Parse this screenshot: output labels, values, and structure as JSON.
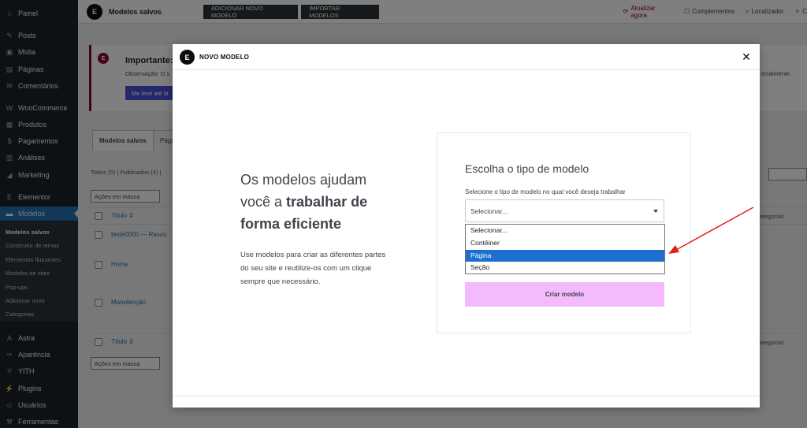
{
  "sidebar": {
    "items": [
      {
        "label": "Painel",
        "icon": "dashboard-icon",
        "glyph": "⌂"
      },
      {
        "label": "Posts",
        "icon": "pin-icon",
        "glyph": "✎"
      },
      {
        "label": "Mídia",
        "icon": "media-icon",
        "glyph": "▣"
      },
      {
        "label": "Páginas",
        "icon": "pages-icon",
        "glyph": "▤"
      },
      {
        "label": "Comentários",
        "icon": "comments-icon",
        "glyph": "✉"
      },
      {
        "label": "WooCommerce",
        "icon": "woocommerce-icon",
        "glyph": "W"
      },
      {
        "label": "Produtos",
        "icon": "products-icon",
        "glyph": "▦"
      },
      {
        "label": "Pagamentos",
        "icon": "payments-icon",
        "glyph": "$"
      },
      {
        "label": "Análises",
        "icon": "analytics-icon",
        "glyph": "▥"
      },
      {
        "label": "Marketing",
        "icon": "megaphone-icon",
        "glyph": "◢"
      },
      {
        "label": "Elementor",
        "icon": "elementor-icon",
        "glyph": "E"
      },
      {
        "label": "Modelos",
        "icon": "folder-icon",
        "glyph": "▬"
      },
      {
        "label": "Astra",
        "icon": "astra-icon",
        "glyph": "A"
      },
      {
        "label": "Aparência",
        "icon": "brush-icon",
        "glyph": "✑"
      },
      {
        "label": "YITH",
        "icon": "yith-icon",
        "glyph": "Y"
      },
      {
        "label": "Plugins",
        "icon": "plug-icon",
        "glyph": "⚡"
      },
      {
        "label": "Usuários",
        "icon": "users-icon",
        "glyph": "☺"
      },
      {
        "label": "Ferramentas",
        "icon": "wrench-icon",
        "glyph": "⚒"
      }
    ],
    "submenu": [
      "Modelos salvos",
      "Construtor de temas",
      "Elementos flutuantes",
      "Modelos de sites",
      "Pop-ups",
      "Adicionar novo",
      "Categorias"
    ]
  },
  "topbar": {
    "title": "Modelos salvos",
    "add_new": "Adicionar novo modelo",
    "import": "Importar modelos",
    "update_now": "Atualizar agora",
    "complements": "Complementos",
    "finder": "Localizador",
    "connected": "C"
  },
  "notice": {
    "title": "Importante:",
    "body": "Observação: O s",
    "body_end": "ecialmente.",
    "button": "Me leve até lá"
  },
  "tabs": [
    "Modelos salvos",
    "Pági"
  ],
  "filters": {
    "views": "Todos (5) | Publicados (4) |",
    "bulk_actions": "Ações em massa"
  },
  "table": {
    "col_title": "Título",
    "col_categories": "ategorias",
    "rows": [
      "teste0000 — Rascu",
      "Home",
      "Manutenção"
    ]
  },
  "modal": {
    "title": "NOVO MODELO",
    "heading_plain": "Os modelos ajudam você a ",
    "heading_bold": "trabalhar de forma eficiente",
    "description": "Use modelos para criar as diferentes partes do seu site e reutilize-os com um clique sempre que necessário.",
    "form_title": "Escolha o tipo de modelo",
    "form_label": "Selecione o tipo de modelo no qual você deseja trabalhar",
    "select_value": "Selecionar...",
    "options": [
      "Selecionar...",
      "Contêiner",
      "Página",
      "Seção"
    ],
    "highlighted_option": "Página",
    "create_button": "Criar modelo"
  },
  "colors": {
    "sidebar_bg": "#1d2327",
    "wp_blue": "#2271b1",
    "elementor_accent": "#93003f",
    "create_button_bg": "#f3bafd",
    "option_highlight": "#1e6ecf",
    "annotation_arrow": "#e02020"
  }
}
